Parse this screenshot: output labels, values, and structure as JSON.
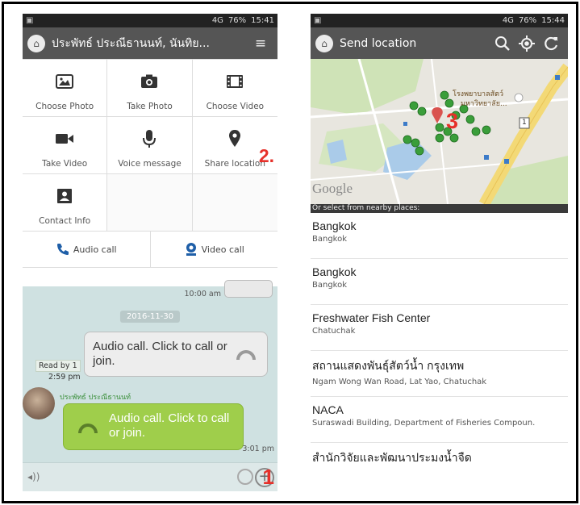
{
  "left_screen": {
    "status": {
      "battery": "76%",
      "time": "15:41",
      "network": "4G"
    },
    "header": {
      "title": "ประพัทธ์ ประณีธานนท์, นันทิย..."
    },
    "attach_grid": [
      {
        "label": "Choose Photo",
        "icon": "photo-icon"
      },
      {
        "label": "Take Photo",
        "icon": "camera-icon"
      },
      {
        "label": "Choose Video",
        "icon": "film-icon"
      },
      {
        "label": "Take Video",
        "icon": "video-camera-icon"
      },
      {
        "label": "Voice message",
        "icon": "microphone-icon"
      },
      {
        "label": "Share location",
        "icon": "location-pin-icon"
      },
      {
        "label": "Contact Info",
        "icon": "contact-card-icon"
      }
    ],
    "step_2": "2.",
    "calls": {
      "audio": "Audio call",
      "video": "Video call"
    },
    "chat": {
      "prev_time": "10:00 am",
      "date": "2016-11-30",
      "msg1": "Audio call. Click to call or join.",
      "read_by": "Read by 1",
      "read_time": "2:59 pm",
      "sender": "ประพัทธ์ ประณีธานนท์",
      "msg2": "Audio call. Click to call or join.",
      "msg2_time": "3:01 pm"
    },
    "step_1": "1"
  },
  "right_screen": {
    "status": {
      "battery": "76%",
      "time": "15:44",
      "network": "4G"
    },
    "header": {
      "title": "Send location"
    },
    "map": {
      "logo_text": "Google",
      "label_hospital": "โรงพยาบาลสัตว์",
      "label_university": "มหาวิทยาลัย...",
      "road_marker": "1"
    },
    "step_3": "3",
    "nearby_label": "Or select from nearby places:",
    "places": [
      {
        "name": "Bangkok",
        "address": "Bangkok"
      },
      {
        "name": "Bangkok",
        "address": "Bangkok"
      },
      {
        "name": "Freshwater Fish Center",
        "address": "Chatuchak"
      },
      {
        "name": "สถานแสดงพันธุ์สัตว์น้ำ กรุงเทพ",
        "address": "Ngam Wong Wan Road, Lat Yao, Chatuchak"
      },
      {
        "name": "NACA",
        "address": "Suraswadi Building, Department of Fisheries Compoun."
      },
      {
        "name": "สำนักวิจัยและพัฒนาประมงน้ำจืด",
        "address": ""
      }
    ]
  },
  "colors": {
    "appbar": "#555555",
    "accent_red": "#e6302a",
    "bubble_green": "#9fce4b",
    "chat_bg": "#cfe1e1"
  }
}
